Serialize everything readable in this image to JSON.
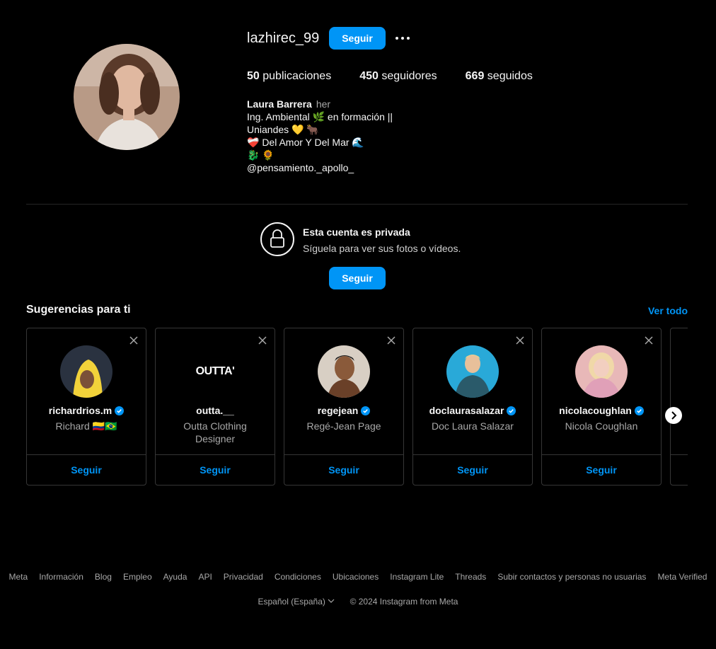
{
  "profile": {
    "username": "lazhirec_99",
    "follow_label": "Seguir",
    "stats": {
      "posts_count": "50",
      "posts_label": "publicaciones",
      "followers_count": "450",
      "followers_label": "seguidores",
      "following_count": "669",
      "following_label": "seguidos"
    },
    "bio": {
      "name": "Laura Barrera",
      "pronoun": "her",
      "line1": "Ing. Ambiental 🌿  en formación ||",
      "line2": "Uniandes 💛 🐂",
      "line3": "❤️‍🩹 Del Amor Y Del Mar 🌊",
      "line4": "🐉 🌻",
      "line5": "@pensamiento._apollo_"
    }
  },
  "private_notice": {
    "title": "Esta cuenta es privada",
    "subtitle": "Síguela para ver sus fotos o vídeos.",
    "follow_label": "Seguir"
  },
  "suggestions": {
    "title": "Sugerencias para ti",
    "see_all": "Ver todo",
    "cards": [
      {
        "handle": "richardrios.m",
        "name": "Richard 🇨🇴🇧🇷",
        "verified": true,
        "follow": "Seguir"
      },
      {
        "handle": "outta.__",
        "name": "Outta Clothing Designer",
        "verified": false,
        "follow": "Seguir",
        "logo_text": "OUTTA'"
      },
      {
        "handle": "regejean",
        "name": "Regé-Jean Page",
        "verified": true,
        "follow": "Seguir"
      },
      {
        "handle": "doclaurasalazar",
        "name": "Doc Laura Salazar",
        "verified": true,
        "follow": "Seguir"
      },
      {
        "handle": "nicolacoughlan",
        "name": "Nicola Coughlan",
        "verified": true,
        "follow": "Seguir"
      }
    ]
  },
  "footer": {
    "links": [
      "Meta",
      "Información",
      "Blog",
      "Empleo",
      "Ayuda",
      "API",
      "Privacidad",
      "Condiciones",
      "Ubicaciones",
      "Instagram Lite",
      "Threads",
      "Subir contactos y personas no usuarias",
      "Meta Verified"
    ],
    "language": "Español (España)",
    "copyright": "© 2024 Instagram from Meta"
  },
  "colors": {
    "background": "#000000",
    "accent": "#0095f6",
    "muted": "#a8a8a8",
    "border": "#363636"
  }
}
